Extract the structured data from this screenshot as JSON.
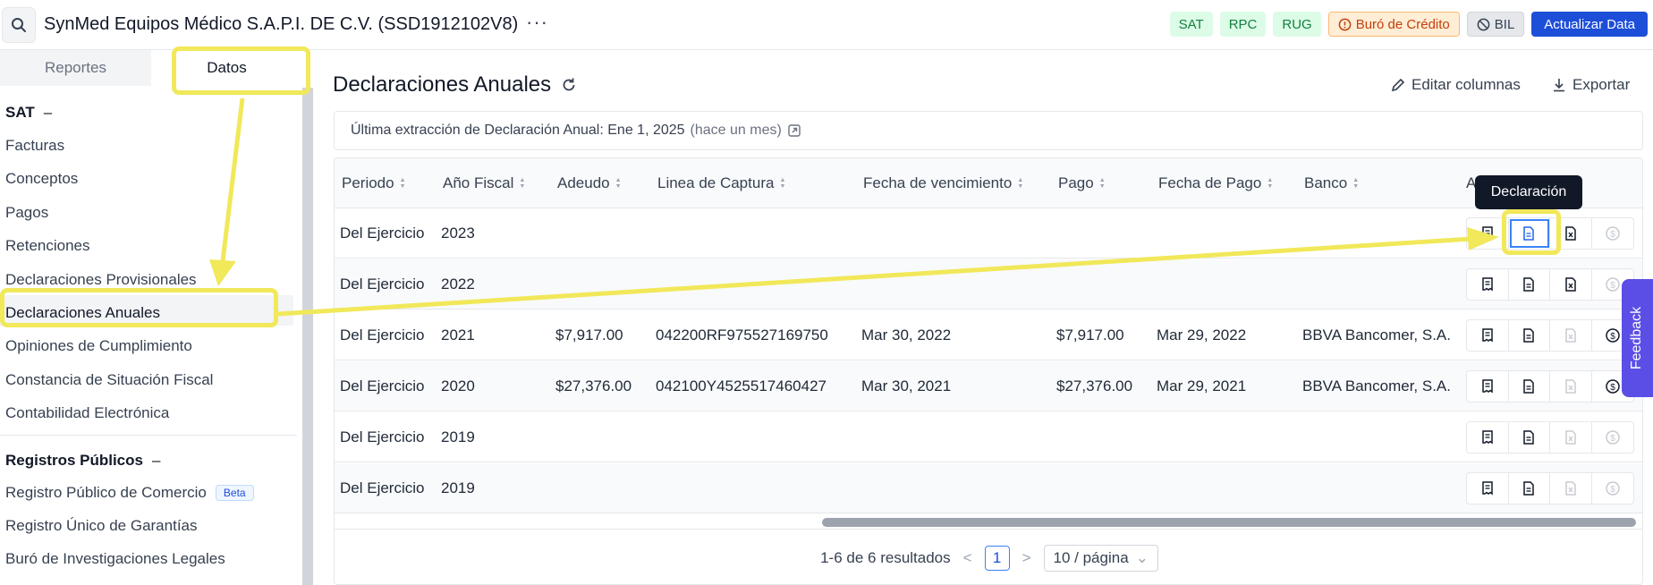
{
  "header": {
    "company": "SynMed Equipos Médico S.A.P.I. DE C.V. (SSD1912102V8)",
    "more": "···",
    "tags": [
      {
        "label": "SAT",
        "kind": "green"
      },
      {
        "label": "RPC",
        "kind": "green"
      },
      {
        "label": "RUG",
        "kind": "green"
      },
      {
        "label": "Buró de Crédito",
        "kind": "orange",
        "icon": "alert-circle-icon"
      },
      {
        "label": "BIL",
        "kind": "gray",
        "icon": "ban-icon"
      }
    ],
    "refresh_button": "Actualizar Data"
  },
  "sidebar": {
    "tabs": [
      "Reportes",
      "Datos"
    ],
    "active_tab": "Datos",
    "sections": [
      {
        "title": "SAT",
        "collapse": "–",
        "items": [
          "Facturas",
          "Conceptos",
          "Pagos",
          "Retenciones",
          "Declaraciones Provisionales",
          "Declaraciones Anuales",
          "Opiniones de Cumplimiento",
          "Constancia de Situación Fiscal",
          "Contabilidad Electrónica"
        ]
      },
      {
        "title": "Registros Públicos",
        "collapse": "–",
        "items": [
          "Registro Público de Comercio",
          "Registro Único de Garantías",
          "Buró de Investigaciones Legales"
        ]
      }
    ],
    "active_item": "Declaraciones Anuales",
    "beta_badge": "Beta"
  },
  "main": {
    "title": "Declaraciones Anuales",
    "edit_columns": "Editar columnas",
    "export": "Exportar",
    "info_text": "Última extracción de Declaración Anual: Ene 1, 2025",
    "info_relative": "(hace un mes)",
    "columns": [
      "Periodo",
      "Año Fiscal",
      "Adeudo",
      "Linea de Captura",
      "Fecha de vencimiento",
      "Pago",
      "Fecha de Pago",
      "Banco",
      "A"
    ],
    "rows": [
      {
        "periodo": "Del Ejercicio",
        "anio": "2023",
        "adeudo": "",
        "linea": "",
        "vencimiento": "",
        "pago": "",
        "fecha_pago": "",
        "banco": "",
        "pdf_enabled": true,
        "pay_enabled": false
      },
      {
        "periodo": "Del Ejercicio",
        "anio": "2022",
        "adeudo": "",
        "linea": "",
        "vencimiento": "",
        "pago": "",
        "fecha_pago": "",
        "banco": "",
        "pdf_enabled": true,
        "pay_enabled": false
      },
      {
        "periodo": "Del Ejercicio",
        "anio": "2021",
        "adeudo": "$7,917.00",
        "linea": "042200RF975527169750",
        "vencimiento": "Mar 30, 2022",
        "pago": "$7,917.00",
        "fecha_pago": "Mar 29, 2022",
        "banco": "BBVA Bancomer, S.A.",
        "pdf_enabled": false,
        "pay_enabled": true
      },
      {
        "periodo": "Del Ejercicio",
        "anio": "2020",
        "adeudo": "$27,376.00",
        "linea": "042100Y4525517460427",
        "vencimiento": "Mar 30, 2021",
        "pago": "$27,376.00",
        "fecha_pago": "Mar 29, 2021",
        "banco": "BBVA Bancomer, S.A.",
        "pdf_enabled": false,
        "pay_enabled": true
      },
      {
        "periodo": "Del Ejercicio",
        "anio": "2019",
        "adeudo": "",
        "linea": "",
        "vencimiento": "",
        "pago": "",
        "fecha_pago": "",
        "banco": "",
        "pdf_enabled": false,
        "pay_enabled": false
      },
      {
        "periodo": "Del Ejercicio",
        "anio": "2019",
        "adeudo": "",
        "linea": "",
        "vencimiento": "",
        "pago": "",
        "fecha_pago": "",
        "banco": "",
        "pdf_enabled": false,
        "pay_enabled": false
      }
    ],
    "tooltip": "Declaración",
    "pagination": {
      "summary": "1-6 de 6 resultados",
      "prev": "<",
      "page": "1",
      "next": ">",
      "page_size": "10 / página"
    }
  },
  "feedback": "Feedback",
  "colors": {
    "accent": "#1d4ed8",
    "highlight": "#f1e85a",
    "feedback": "#5b4ee6"
  }
}
